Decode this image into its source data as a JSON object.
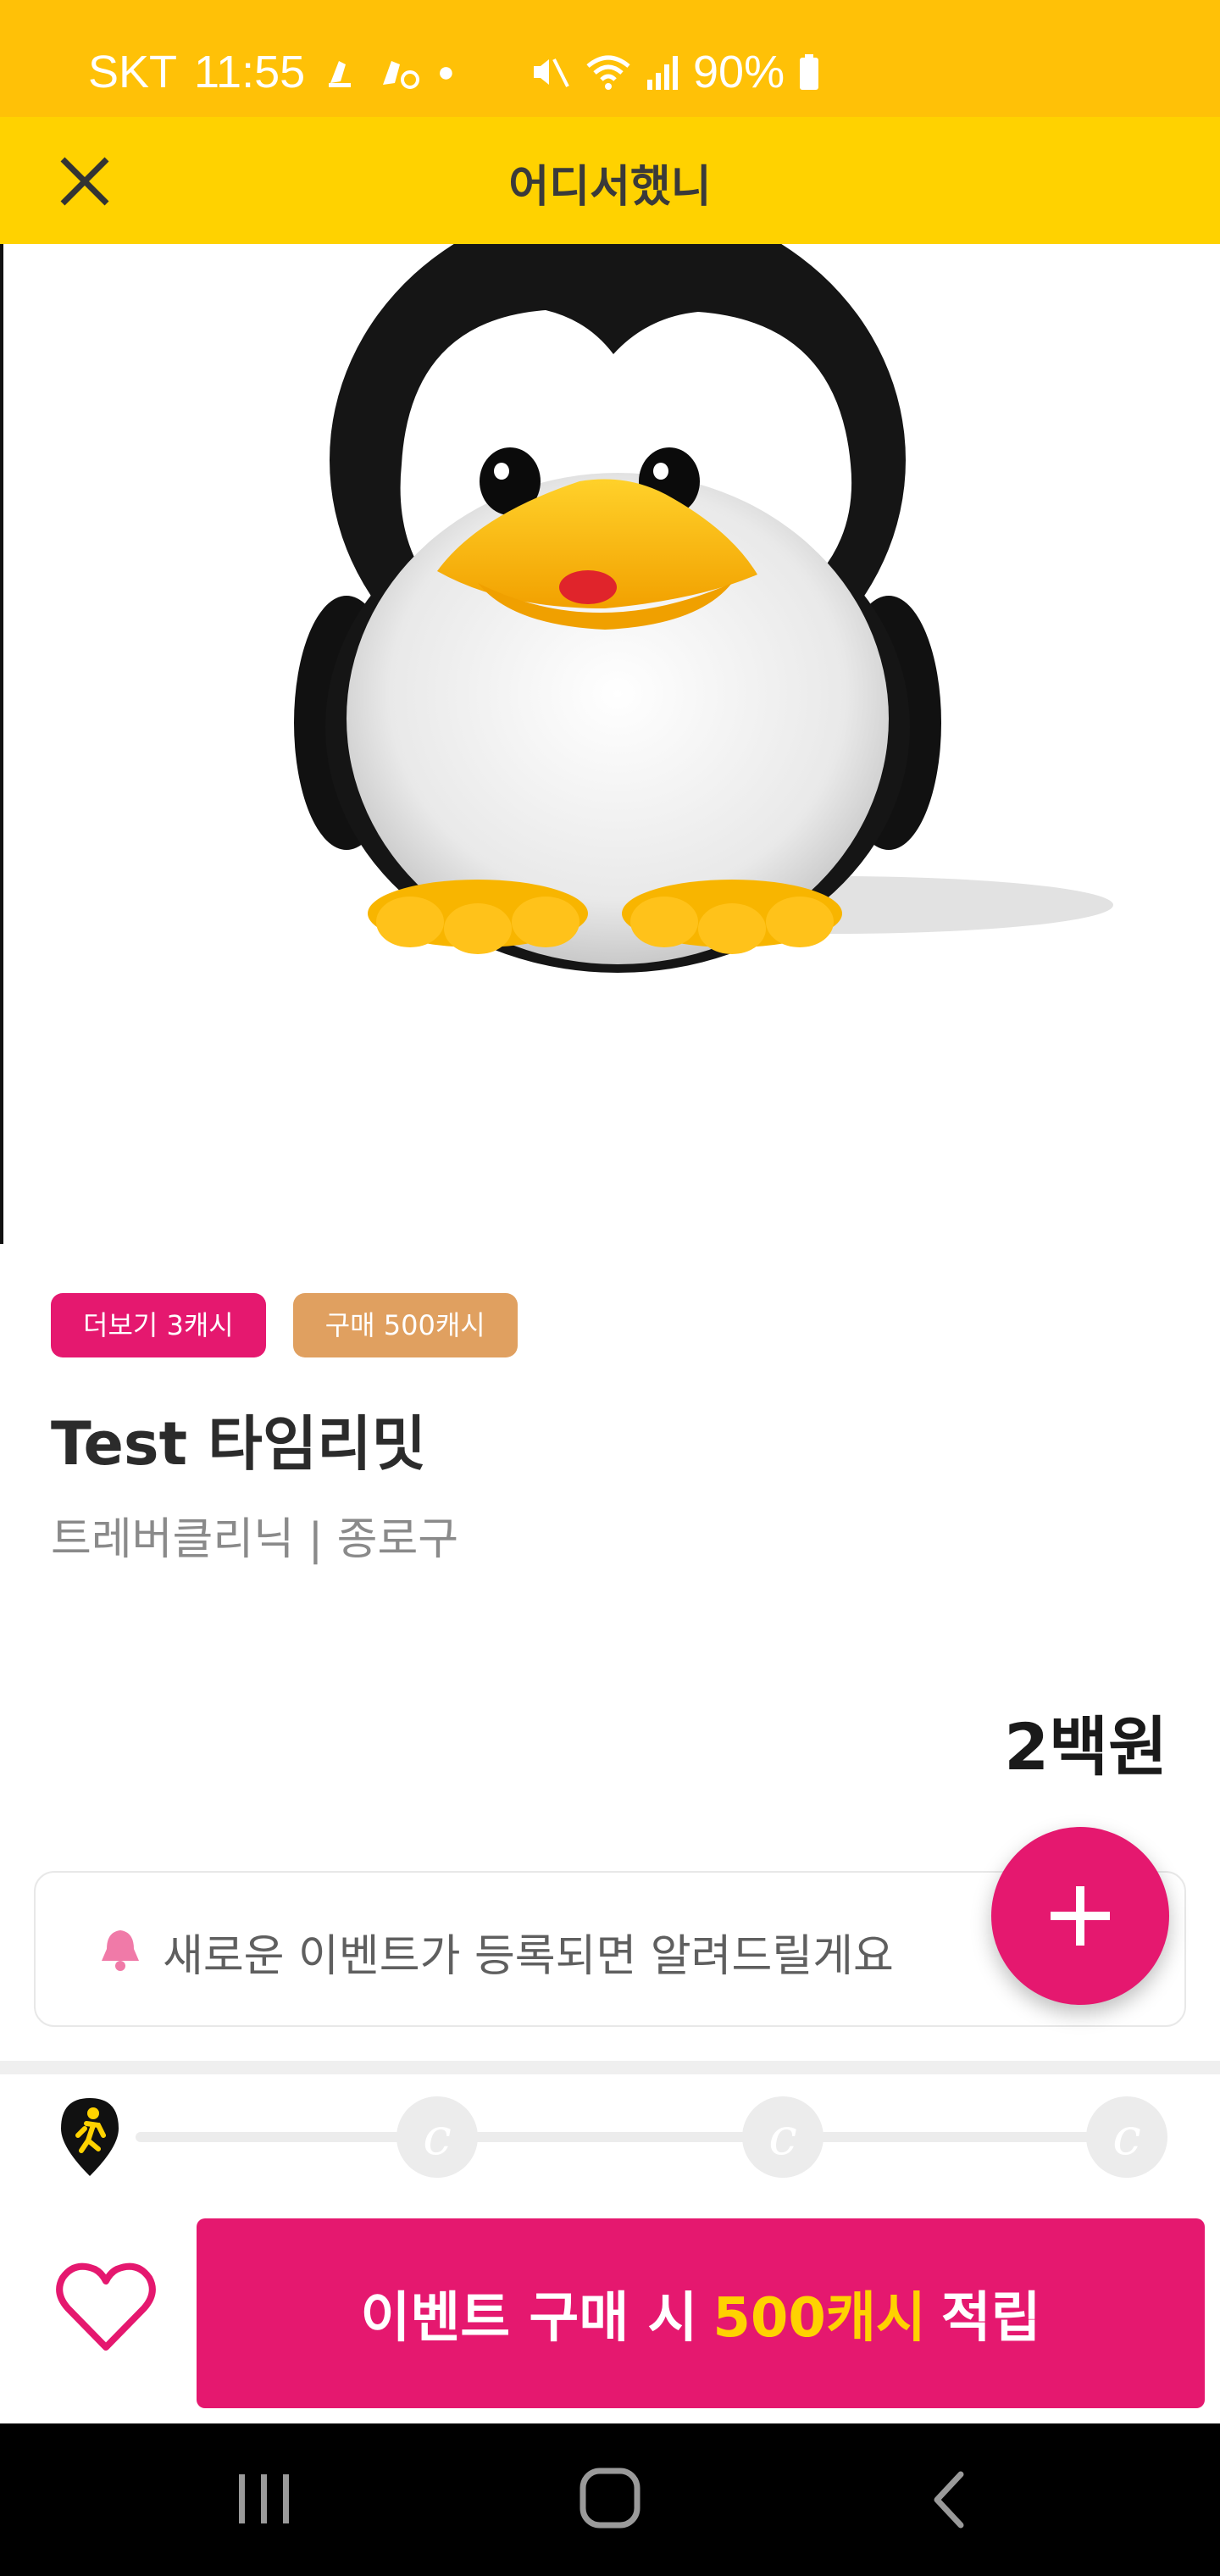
{
  "status_bar": {
    "carrier": "SKT",
    "time": "11:55",
    "battery": "90%"
  },
  "toolbar": {
    "title": "어디서했니",
    "close_icon": "close-icon"
  },
  "badges": [
    {
      "label": "더보기 3캐시",
      "color": "#E5186F"
    },
    {
      "label": "구매 500캐시",
      "color": "#E0A060"
    }
  ],
  "event": {
    "title": "Test 타임리밋",
    "subtitle": "트레버클리닉 | 종로구",
    "price": "2백원"
  },
  "notify": {
    "text": "새로운 이벤트가 등록되면 알려드릴게요",
    "icon": "bell-icon"
  },
  "progress": {
    "coin_glyph": "c",
    "steps": 4
  },
  "cta": {
    "prefix": "이벤트 구매 시",
    "highlight": "500캐시",
    "suffix": "적립"
  },
  "colors": {
    "accent": "#E5186F",
    "yellow": "#FFD200",
    "status_yellow": "#FFC107"
  }
}
